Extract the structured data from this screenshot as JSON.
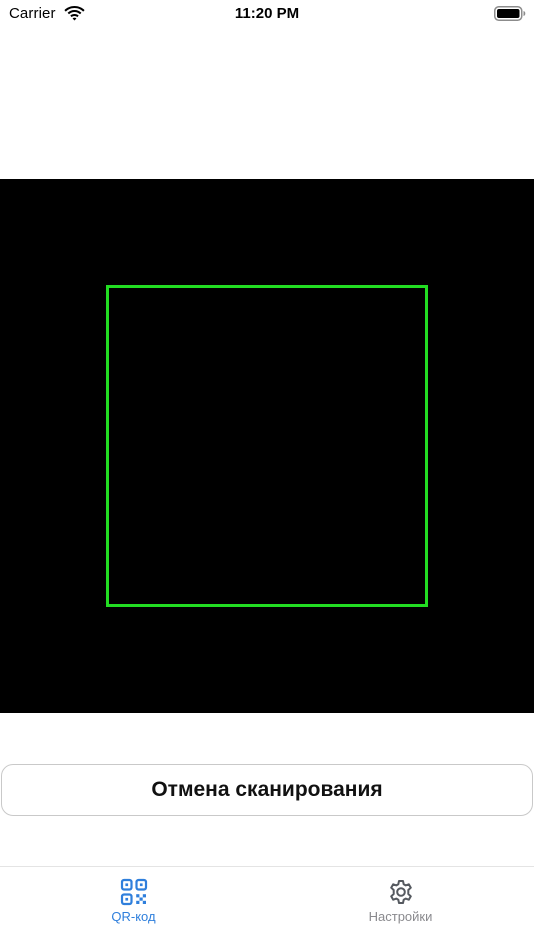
{
  "status_bar": {
    "carrier": "Carrier",
    "time": "11:20 PM"
  },
  "scanner": {
    "frame_color": "#22dd22",
    "background_color": "#000000"
  },
  "actions": {
    "cancel_label": "Отмена сканирования"
  },
  "tab_bar": {
    "active_color": "#2f7fdc",
    "inactive_color": "#8a8a8e",
    "tabs": [
      {
        "label": "QR-код",
        "icon": "qr-code-icon",
        "active": true
      },
      {
        "label": "Настройки",
        "icon": "gear-icon",
        "active": false
      }
    ]
  }
}
